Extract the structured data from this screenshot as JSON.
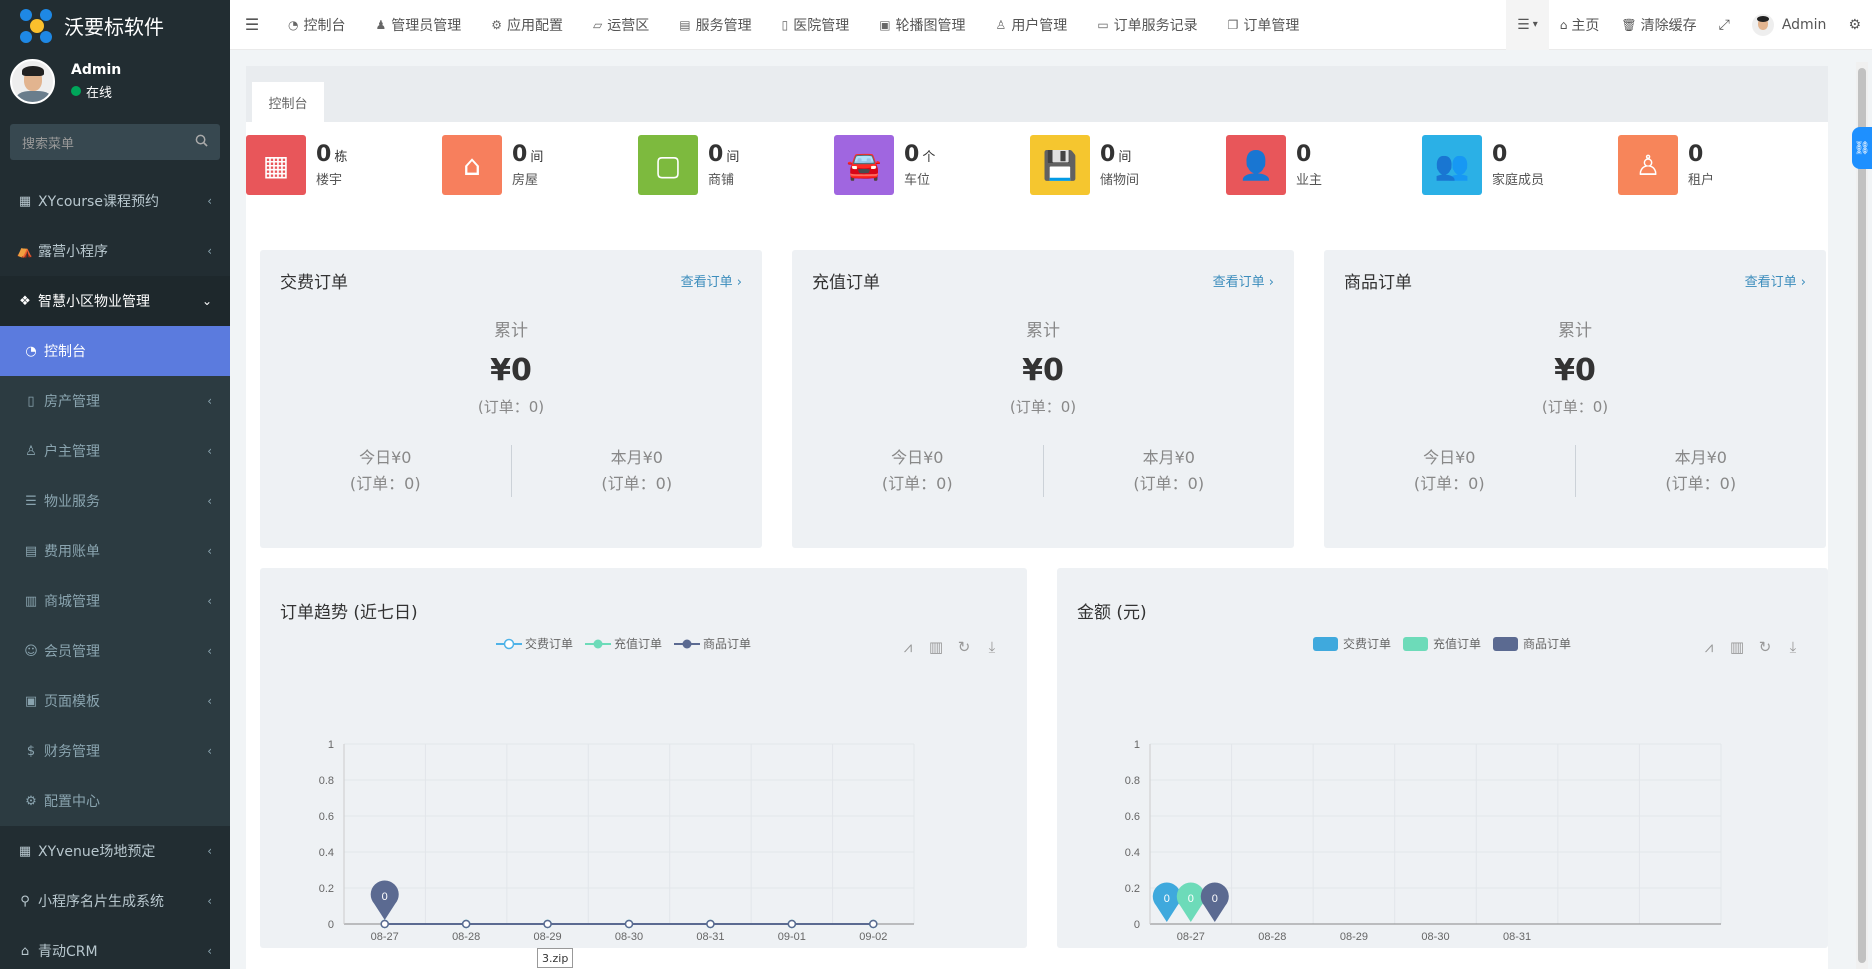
{
  "app": {
    "name": "沃要标软件"
  },
  "user": {
    "name": "Admin",
    "status": "在线"
  },
  "search": {
    "placeholder": "搜索菜单"
  },
  "sidebar": {
    "items": [
      {
        "label": "XYcourse课程预约",
        "icon": "grid-icon"
      },
      {
        "label": "露营小程序",
        "icon": "tent-icon"
      },
      {
        "label": "智慧小区物业管理",
        "icon": "cubes-icon"
      },
      {
        "label": "控制台",
        "icon": "dashboard-icon"
      },
      {
        "label": "房产管理",
        "icon": "building-icon"
      },
      {
        "label": "户主管理",
        "icon": "user-icon"
      },
      {
        "label": "物业服务",
        "icon": "list-icon"
      },
      {
        "label": "费用账单",
        "icon": "bill-icon"
      },
      {
        "label": "商城管理",
        "icon": "shop-icon"
      },
      {
        "label": "会员管理",
        "icon": "member-icon"
      },
      {
        "label": "页面模板",
        "icon": "image-icon"
      },
      {
        "label": "财务管理",
        "icon": "dollar-icon"
      },
      {
        "label": "配置中心",
        "icon": "gear-icon"
      },
      {
        "label": "XYvenue场地预定",
        "icon": "grid-icon"
      },
      {
        "label": "小程序名片生成系统",
        "icon": "pin-icon"
      },
      {
        "label": "青动CRM",
        "icon": "home-icon"
      }
    ]
  },
  "navbar": {
    "tabs": [
      {
        "label": "控制台",
        "icon": "dashboard-icon"
      },
      {
        "label": "管理员管理",
        "icon": "user-icon"
      },
      {
        "label": "应用配置",
        "icon": "gear-icon"
      },
      {
        "label": "运营区",
        "icon": "map-icon"
      },
      {
        "label": "服务管理",
        "icon": "list-icon"
      },
      {
        "label": "医院管理",
        "icon": "clipboard-icon"
      },
      {
        "label": "轮播图管理",
        "icon": "image-icon"
      },
      {
        "label": "用户管理",
        "icon": "user-icon"
      },
      {
        "label": "订单服务记录",
        "icon": "file-icon"
      },
      {
        "label": "订单管理",
        "icon": "copy-icon"
      }
    ],
    "home": "主页",
    "clear_cache": "清除缓存",
    "admin": "Admin"
  },
  "page_tab": "控制台",
  "stats": [
    {
      "num": "0",
      "unit": "栋",
      "label": "楼宇",
      "color": "#e8565a"
    },
    {
      "num": "0",
      "unit": "间",
      "label": "房屋",
      "color": "#f77f5d"
    },
    {
      "num": "0",
      "unit": "间",
      "label": "商铺",
      "color": "#7dba3e"
    },
    {
      "num": "0",
      "unit": "个",
      "label": "车位",
      "color": "#a066e0"
    },
    {
      "num": "0",
      "unit": "间",
      "label": "储物间",
      "color": "#f5c62f"
    },
    {
      "num": "0",
      "unit": "",
      "label": "业主",
      "color": "#e8565a"
    },
    {
      "num": "0",
      "unit": "",
      "label": "家庭成员",
      "color": "#2bb0e6"
    },
    {
      "num": "0",
      "unit": "",
      "label": "租户",
      "color": "#f7855a"
    }
  ],
  "orders": [
    {
      "title": "交费订单",
      "link": "查看订单 ›",
      "cum_label": "累计",
      "cum_value": "¥0",
      "cum_count": "(订单：0)",
      "today": "今日¥0",
      "today_count": "(订单：0)",
      "month": "本月¥0",
      "month_count": "(订单：0)"
    },
    {
      "title": "充值订单",
      "link": "查看订单 ›",
      "cum_label": "累计",
      "cum_value": "¥0",
      "cum_count": "(订单：0)",
      "today": "今日¥0",
      "today_count": "(订单：0)",
      "month": "本月¥0",
      "month_count": "(订单：0)"
    },
    {
      "title": "商品订单",
      "link": "查看订单 ›",
      "cum_label": "累计",
      "cum_value": "¥0",
      "cum_count": "(订单：0)",
      "today": "今日¥0",
      "today_count": "(订单：0)",
      "month": "本月¥0",
      "month_count": "(订单：0)"
    }
  ],
  "chart_data": [
    {
      "type": "line",
      "title": "订单趋势 (近七日)",
      "x": [
        "08-27",
        "08-28",
        "08-29",
        "08-30",
        "08-31",
        "09-01",
        "09-02"
      ],
      "ylim": [
        0,
        1
      ],
      "yticks": [
        "0",
        "0.2",
        "0.4",
        "0.6",
        "0.8",
        "1"
      ],
      "series": [
        {
          "name": "交费订单",
          "color": "#4fb3e8",
          "values": [
            0,
            0,
            0,
            0,
            0,
            0,
            0
          ]
        },
        {
          "name": "充值订单",
          "color": "#6ddbb9",
          "values": [
            0,
            0,
            0,
            0,
            0,
            0,
            0
          ]
        },
        {
          "name": "商品订单",
          "color": "#5b6a91",
          "values": [
            0,
            0,
            0,
            0,
            0,
            0,
            0
          ]
        }
      ],
      "max_marker": "0",
      "grid": true,
      "legend": "top-center"
    },
    {
      "type": "bar",
      "title": "金额 (元)",
      "x": [
        "08-27",
        "08-28",
        "08-29",
        "08-30",
        "08-31"
      ],
      "ylim": [
        0,
        1
      ],
      "yticks": [
        "0",
        "0.2",
        "0.4",
        "0.6",
        "0.8",
        "1"
      ],
      "series": [
        {
          "name": "交费订单",
          "color": "#3fa9dd",
          "values": [
            0,
            0,
            0,
            0,
            0
          ]
        },
        {
          "name": "充值订单",
          "color": "#6ddbb9",
          "values": [
            0,
            0,
            0,
            0,
            0
          ]
        },
        {
          "name": "商品订单",
          "color": "#5b6a91",
          "values": [
            0,
            0,
            0,
            0,
            0
          ]
        }
      ],
      "max_marker": "0",
      "grid": true,
      "legend": "top-center"
    }
  ],
  "tooltip": "3.zip"
}
